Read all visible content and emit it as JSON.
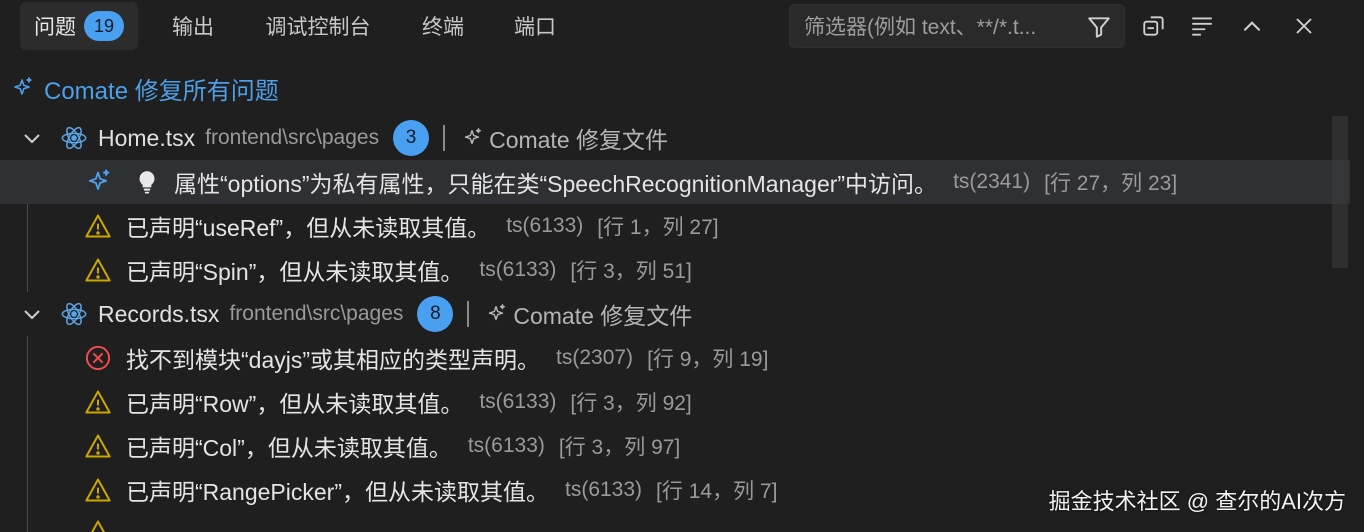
{
  "tabs": {
    "problems": {
      "label": "问题",
      "count": "19"
    },
    "output": {
      "label": "输出"
    },
    "debug_console": {
      "label": "调试控制台"
    },
    "terminal": {
      "label": "终端"
    },
    "ports": {
      "label": "端口"
    }
  },
  "filter": {
    "placeholder": "筛选器(例如 text、**/*.t..."
  },
  "fix_all": {
    "label": "Comate 修复所有问题"
  },
  "files": [
    {
      "name": "Home.tsx",
      "path": "frontend\\src\\pages",
      "count": "3",
      "fix_label": "Comate 修复文件",
      "problems": [
        {
          "severity": "info",
          "text": "属性“options”为私有属性，只能在类“SpeechRecognitionManager”中访问。",
          "code": "ts(2341)",
          "pos": "[行 27，列 23]"
        },
        {
          "severity": "warning",
          "text": "已声明“useRef”，但从未读取其值。",
          "code": "ts(6133)",
          "pos": "[行 1，列 27]"
        },
        {
          "severity": "warning",
          "text": "已声明“Spin”，但从未读取其值。",
          "code": "ts(6133)",
          "pos": "[行 3，列 51]"
        }
      ]
    },
    {
      "name": "Records.tsx",
      "path": "frontend\\src\\pages",
      "count": "8",
      "fix_label": "Comate 修复文件",
      "problems": [
        {
          "severity": "error",
          "text": "找不到模块“dayjs”或其相应的类型声明。",
          "code": "ts(2307)",
          "pos": "[行 9，列 19]"
        },
        {
          "severity": "warning",
          "text": "已声明“Row”，但从未读取其值。",
          "code": "ts(6133)",
          "pos": "[行 3，列 92]"
        },
        {
          "severity": "warning",
          "text": "已声明“Col”，但从未读取其值。",
          "code": "ts(6133)",
          "pos": "[行 3，列 97]"
        },
        {
          "severity": "warning",
          "text": "已声明“RangePicker”，但从未读取其值。",
          "code": "ts(6133)",
          "pos": "[行 14，列 7]"
        }
      ]
    }
  ],
  "watermark": "掘金技术社区 @ 查尔的AI次方",
  "colors": {
    "accent": "#4aa0f0",
    "warning": "#cca700",
    "error": "#f14c4c",
    "link": "#4d9fe8"
  },
  "icons": [
    "filter-icon",
    "collapse-all-icon",
    "view-as-list-icon",
    "maximize-panel-icon",
    "close-icon",
    "sparkle-icon",
    "chevron-down-icon",
    "react-icon",
    "warning-icon",
    "error-icon",
    "lightbulb-icon"
  ]
}
